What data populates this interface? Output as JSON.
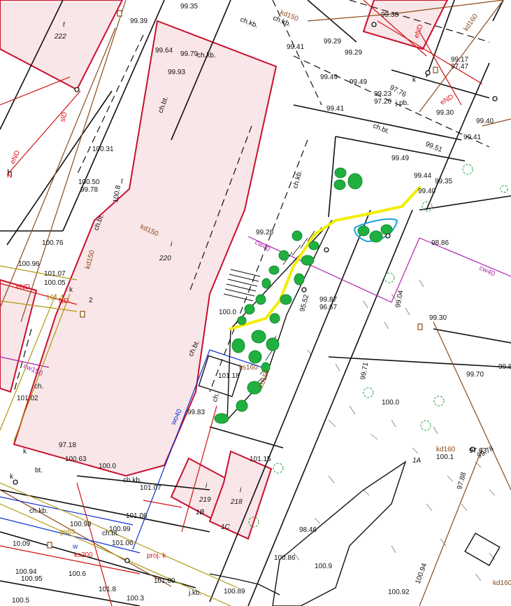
{
  "colors": {
    "background": "#ffffff",
    "building_fill": "#f8e6e8",
    "building_stroke": "#c8102e",
    "line": "#111111",
    "red_line": "#d11111",
    "brown_line": "#8b4a1a",
    "magenta_line": "#b020b0",
    "blue_line": "#1030d0",
    "olive_line": "#b09a10",
    "path_yellow": "#f2ee00",
    "tree_green": "#20b040",
    "pond_blue": "#1aa0e0"
  },
  "buildings": [
    {
      "use": "t",
      "number": "222"
    },
    {
      "use": "i",
      "number": "220"
    },
    {
      "use": "h",
      "number": ""
    },
    {
      "use": "i",
      "number": "219",
      "unit": "1B"
    },
    {
      "use": "i",
      "number": "218",
      "unit": "1C"
    }
  ],
  "labels": [
    {
      "text": "99.35",
      "style": "lbl"
    },
    {
      "text": "99.39",
      "style": "lbl"
    },
    {
      "text": "ch.kb.",
      "style": "lbl"
    },
    {
      "text": "ch.kb.",
      "style": "lbl"
    },
    {
      "text": "kd150",
      "style": "lbl-brown"
    },
    {
      "text": "99.38",
      "style": "lbl"
    },
    {
      "text": "eND",
      "style": "lbl-red"
    },
    {
      "text": "kd160",
      "style": "lbl-brown"
    },
    {
      "text": "99.64",
      "style": "lbl"
    },
    {
      "text": "99.79",
      "style": "lbl"
    },
    {
      "text": "ch.kb.",
      "style": "lbl"
    },
    {
      "text": "99.41",
      "style": "lbl"
    },
    {
      "text": "99.29",
      "style": "lbl"
    },
    {
      "text": "99.29",
      "style": "lbl"
    },
    {
      "text": "99.17",
      "style": "lbl"
    },
    {
      "text": "97.47",
      "style": "lbl"
    },
    {
      "text": "99.93",
      "style": "lbl"
    },
    {
      "text": "99.49",
      "style": "lbl"
    },
    {
      "text": "99.49",
      "style": "lbl"
    },
    {
      "text": "97.76",
      "style": "lbl"
    },
    {
      "text": "k",
      "style": "lbl"
    },
    {
      "text": "99.23",
      "style": "lbl"
    },
    {
      "text": "97.20",
      "style": "lbl"
    },
    {
      "text": "j.pb.",
      "style": "lbl"
    },
    {
      "text": "eND",
      "style": "lbl-red"
    },
    {
      "text": "99.41",
      "style": "lbl"
    },
    {
      "text": "99.30",
      "style": "lbl"
    },
    {
      "text": "ch.bt.",
      "style": "lbl"
    },
    {
      "text": "99.40",
      "style": "lbl"
    },
    {
      "text": "99.51",
      "style": "lbl"
    },
    {
      "text": "99.41",
      "style": "lbl"
    },
    {
      "text": "slD",
      "style": "lbl-red"
    },
    {
      "text": "eND",
      "style": "lbl-red"
    },
    {
      "text": "ch.bt.",
      "style": "lbl"
    },
    {
      "text": "100.31",
      "style": "lbl"
    },
    {
      "text": "ch.kb.",
      "style": "lbl"
    },
    {
      "text": "99.49",
      "style": "lbl"
    },
    {
      "text": "99.44",
      "style": "lbl"
    },
    {
      "text": "99.35",
      "style": "lbl"
    },
    {
      "text": "99.40",
      "style": "lbl"
    },
    {
      "text": "100.50",
      "style": "lbl"
    },
    {
      "text": "99.78",
      "style": "lbl"
    },
    {
      "text": "t",
      "style": "lbl-it"
    },
    {
      "text": "100.8",
      "style": "lbl"
    },
    {
      "text": "kd150",
      "style": "lbl-brown"
    },
    {
      "text": "ch.bt.",
      "style": "lbl"
    },
    {
      "text": "100.76",
      "style": "lbl"
    },
    {
      "text": "99.28",
      "style": "lbl"
    },
    {
      "text": "cw40",
      "style": "lbl-mag"
    },
    {
      "text": "98.86",
      "style": "lbl"
    },
    {
      "text": "kd150",
      "style": "lbl-brown"
    },
    {
      "text": "100.96",
      "style": "lbl"
    },
    {
      "text": "cw40",
      "style": "lbl-mag"
    },
    {
      "text": "101.07",
      "style": "lbl"
    },
    {
      "text": "100.05",
      "style": "lbl"
    },
    {
      "text": "eND",
      "style": "lbl-red"
    },
    {
      "text": "k",
      "style": "lbl"
    },
    {
      "text": "101.4",
      "style": "lbl-olive"
    },
    {
      "text": "ND",
      "style": "lbl-red"
    },
    {
      "text": "2",
      "style": "lbl"
    },
    {
      "text": "99.87",
      "style": "lbl"
    },
    {
      "text": "96.67",
      "style": "lbl"
    },
    {
      "text": "95.52",
      "style": "lbl"
    },
    {
      "text": "99.04",
      "style": "lbl"
    },
    {
      "text": "100.0",
      "style": "lbl"
    },
    {
      "text": "99.30",
      "style": "lbl"
    },
    {
      "text": "ch.bt.",
      "style": "lbl"
    },
    {
      "text": "ks160",
      "style": "lbl-brown"
    },
    {
      "text": "kd150",
      "style": "lbl-brown"
    },
    {
      "text": "cw150",
      "style": "lbl-mag"
    },
    {
      "text": "99.71",
      "style": "lbl"
    },
    {
      "text": "99.8",
      "style": "lbl"
    },
    {
      "text": "99.70",
      "style": "lbl"
    },
    {
      "text": "ch.",
      "style": "lbl"
    },
    {
      "text": "101.02",
      "style": "lbl"
    },
    {
      "text": "wo40",
      "style": "lbl-blue"
    },
    {
      "text": "100.0",
      "style": "lbl"
    },
    {
      "text": "99.83",
      "style": "lbl"
    },
    {
      "text": "ch.",
      "style": "lbl"
    },
    {
      "text": "kd160",
      "style": "lbl-brown"
    },
    {
      "text": "100.1",
      "style": "lbl"
    },
    {
      "text": "99.78",
      "style": "lbl"
    },
    {
      "text": "97.63",
      "style": "lbl"
    },
    {
      "text": "97.88",
      "style": "lbl"
    },
    {
      "text": "k",
      "style": "lbl"
    },
    {
      "text": "97.18",
      "style": "lbl"
    },
    {
      "text": "101.15",
      "style": "lbl"
    },
    {
      "text": "1A",
      "style": "lbl-it"
    },
    {
      "text": "100.63",
      "style": "lbl"
    },
    {
      "text": "100.0",
      "style": "lbl"
    },
    {
      "text": "bt.",
      "style": "lbl"
    },
    {
      "text": "ch.kb.",
      "style": "lbl"
    },
    {
      "text": "101.07",
      "style": "lbl"
    },
    {
      "text": "ch.kb.",
      "style": "lbl"
    },
    {
      "text": "101.08",
      "style": "lbl"
    },
    {
      "text": "100.98",
      "style": "lbl"
    },
    {
      "text": "100.99",
      "style": "lbl"
    },
    {
      "text": "gn63",
      "style": "lbl-olive"
    },
    {
      "text": "ch.bt.",
      "style": "lbl"
    },
    {
      "text": "10.09",
      "style": "lbl"
    },
    {
      "text": "w",
      "style": "lbl-blue"
    },
    {
      "text": "ks200",
      "style": "lbl-red"
    },
    {
      "text": "101.06",
      "style": "lbl"
    },
    {
      "text": "98.46",
      "style": "lbl"
    },
    {
      "text": "100.94",
      "style": "lbl"
    },
    {
      "text": "100.6",
      "style": "lbl"
    },
    {
      "text": "proj. k",
      "style": "lbl-red"
    },
    {
      "text": "100.86",
      "style": "lbl"
    },
    {
      "text": "100.95",
      "style": "lbl"
    },
    {
      "text": "100.9",
      "style": "lbl"
    },
    {
      "text": "101.00",
      "style": "lbl"
    },
    {
      "text": "101.8",
      "style": "lbl"
    },
    {
      "text": "j.kb.",
      "style": "lbl"
    },
    {
      "text": "100.89",
      "style": "lbl"
    },
    {
      "text": "100.94",
      "style": "lbl"
    },
    {
      "text": "100.92",
      "style": "lbl"
    },
    {
      "text": "kd160",
      "style": "lbl-brown"
    },
    {
      "text": "100.5",
      "style": "lbl"
    },
    {
      "text": "100.3",
      "style": "lbl"
    },
    {
      "text": "101.18",
      "style": "lbl"
    },
    {
      "text": "k",
      "style": "lbl"
    },
    {
      "text": "h",
      "style": "lbl"
    },
    {
      "text": "N",
      "style": "lbl-red"
    }
  ]
}
